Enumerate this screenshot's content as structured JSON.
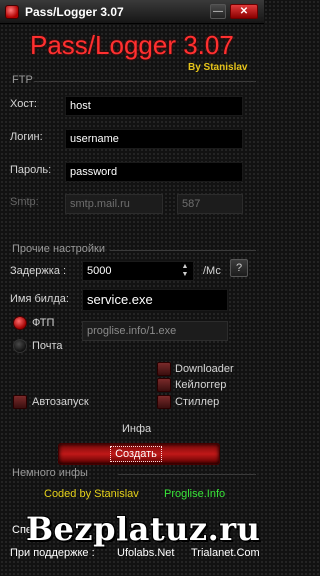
{
  "window": {
    "title": "Pass/Logger 3.07",
    "min": "—",
    "close": "✕"
  },
  "header": {
    "title": "Pass/Logger 3.07",
    "author": "By Stanislav"
  },
  "ftp": {
    "section": "FTP",
    "host_label": "Хост:",
    "host_value": "host",
    "login_label": "Логин:",
    "login_value": "username",
    "password_label": "Пароль:",
    "password_value": "password",
    "smtp_label": "Smtp:",
    "smtp_value": "smtp.mail.ru",
    "smtp_port": "587"
  },
  "other": {
    "section": "Прочие настройки",
    "delay_label": "Задержка :",
    "delay_value": "5000",
    "delay_unit": "/Мс",
    "help": "?",
    "build_label": "Имя билда:",
    "build_value": "service.exe",
    "radio_ftp": "ФТП",
    "radio_mail": "Почта",
    "url_value": "proglise.info/1.exe",
    "downloader": "Downloader",
    "keylogger": "Кейлоггер",
    "stealer": "Стиллер",
    "autorun": "Автозапуск"
  },
  "info": {
    "label": "Инфа",
    "create": "Создать"
  },
  "about": {
    "section": "Немного инфы",
    "coded": "Coded by Stanislav",
    "site": "Proglise.Info",
    "spec_prefix": "Спе",
    "support_label": "При поддержке :",
    "sponsor1": "Ufolabs.Net",
    "sponsor2": "Trialanet.Com"
  },
  "watermark": "Bezplatuz.ru"
}
